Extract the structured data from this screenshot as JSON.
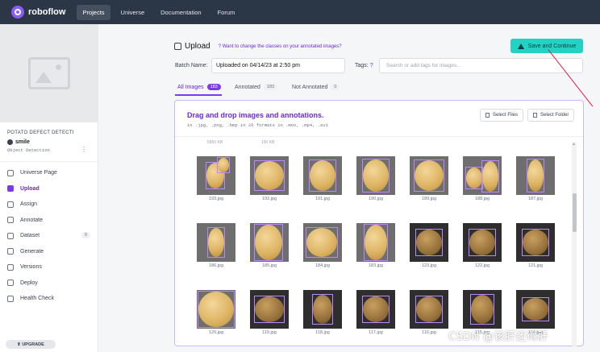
{
  "nav": {
    "brand": "roboflow",
    "items": [
      "Projects",
      "Universe",
      "Documentation",
      "Forum"
    ]
  },
  "sidebar": {
    "project_name": "POTATO DEFECT DETECTI",
    "workspace": "smile",
    "project_type": "Object Detection",
    "items": [
      {
        "label": "Universe Page",
        "icon": "globe-icon"
      },
      {
        "label": "Upload",
        "icon": "upload-icon"
      },
      {
        "label": "Assign",
        "icon": "search-icon"
      },
      {
        "label": "Annotate",
        "icon": "annotate-icon"
      },
      {
        "label": "Dataset",
        "icon": "image-icon",
        "badge": "0"
      },
      {
        "label": "Generate",
        "icon": "generate-icon"
      },
      {
        "label": "Versions",
        "icon": "versions-icon"
      },
      {
        "label": "Deploy",
        "icon": "rocket-icon"
      },
      {
        "label": "Health Check",
        "icon": "health-icon"
      }
    ],
    "upgrade": "UPGRADE"
  },
  "header": {
    "title": "Upload",
    "help_link": "Want to change the classes on your annotated images?",
    "save_button": "Save and Continue"
  },
  "form": {
    "batch_label": "Batch Name:",
    "batch_value": "Uploaded on 04/14/23 at 2:50 pm",
    "tags_label": "Tags:",
    "tags_placeholder": "Search or add tags for images..."
  },
  "tabs": [
    {
      "label": "All Images",
      "count": "183"
    },
    {
      "label": "Annotated",
      "count": "183"
    },
    {
      "label": "Not Annotated",
      "count": "0"
    }
  ],
  "panel": {
    "title": "Drag and drop images and annotations.",
    "formats": "in .jpg, .png, .bmp   in 26 formats   in .mov, .mp4, .avi",
    "select_files": "Select Files",
    "select_folder": "Select Folder",
    "top_sizes": [
      "5950 KB",
      "190 KB"
    ]
  },
  "images": [
    "193.jpg",
    "192.jpg",
    "191.jpg",
    "190.jpg",
    "189.jpg",
    "188.jpg",
    "187.jpg",
    "186.jpg",
    "185.jpg",
    "184.jpg",
    "183.jpg",
    "123.jpg",
    "122.jpg",
    "121.jpg",
    "120.jpg",
    "119.jpg",
    "118.jpg",
    "117.jpg",
    "116.jpg",
    "115.jpg",
    "114.jpg"
  ],
  "watermark": "CSDN @该肝还得肝",
  "colors": {
    "accent": "#7c3aed",
    "save": "#22d3c5",
    "nav_bg": "#2b3646"
  }
}
